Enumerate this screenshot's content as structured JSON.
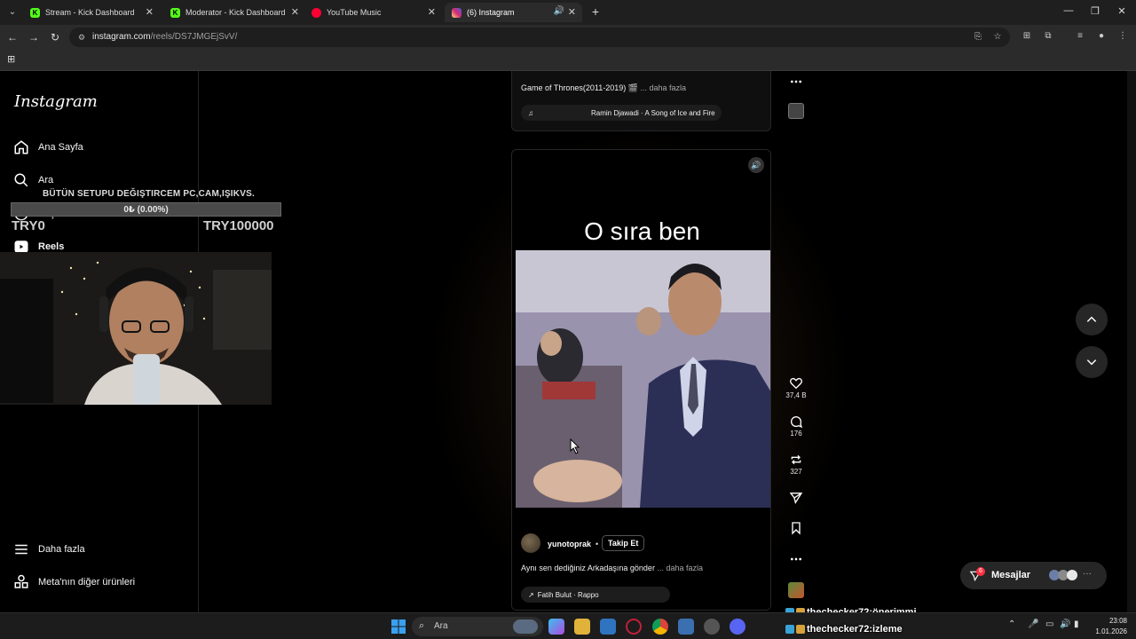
{
  "browser": {
    "tabs": [
      {
        "title": "Stream - Kick Dashboard",
        "favicon": "kick-icon",
        "color": "#53fc18"
      },
      {
        "title": "Moderator - Kick Dashboard",
        "favicon": "kick-icon",
        "color": "#53fc18"
      },
      {
        "title": "YouTube Music",
        "favicon": "youtube-music-icon",
        "color": "#ff0033"
      },
      {
        "title": "(6) Instagram",
        "favicon": "instagram-icon",
        "color": "#e1306c"
      }
    ],
    "url_host": "instagram.com",
    "url_path": "/reels/DS7JMGEjSvV/"
  },
  "sidebar": {
    "logo": "Instagram",
    "items": [
      {
        "label": "Ana Sayfa",
        "icon": "home-icon"
      },
      {
        "label": "Ara",
        "icon": "search-icon"
      },
      {
        "label": "Keşfet",
        "icon": "compass-icon"
      },
      {
        "label": "Reels",
        "icon": "reels-icon"
      }
    ],
    "bottom": [
      {
        "label": "Daha fazla",
        "icon": "menu-icon"
      },
      {
        "label": "Meta'nın diğer ürünleri",
        "icon": "meta-products-icon"
      }
    ]
  },
  "overlay": {
    "goal_title": "BÜTÜN SETUPU DEĞIŞTIRCEM PC,CAM,IŞIKVS.",
    "goal_progress": "0₺ (0.00%)",
    "goal_fraction": 0.0,
    "min": "TRY0",
    "max": "TRY100000"
  },
  "prev_reel": {
    "caption": "Game of Thrones(2011-2019) 🎬",
    "more": "... daha fazla",
    "audio": "Ramin Djawadi · A Song of Ice and Fire"
  },
  "reel": {
    "title": "O sıra ben",
    "username": "yunotoprak",
    "dot": "•",
    "follow": "Takip Et",
    "caption": "Aynı sen dediğiniz Arkadaşına gönder",
    "more": "... daha fazla",
    "audio": "Fatih Bulut · Rappo"
  },
  "actions": {
    "likes": "37,4 B",
    "comments": "176",
    "reposts": "327"
  },
  "messages": {
    "label": "Mesajlar",
    "badge": "6"
  },
  "chat": [
    {
      "user": "thechecker72",
      "sep": " : ",
      "text": "önerimmi"
    },
    {
      "user": "thechecker72",
      "sep": " : ",
      "text": "izleme"
    }
  ],
  "taskbar": {
    "search": "Ara",
    "time": "23:08",
    "date": "1.01.2026"
  },
  "colors": {
    "accent": "#0095f6",
    "badge": "#ff3040"
  }
}
